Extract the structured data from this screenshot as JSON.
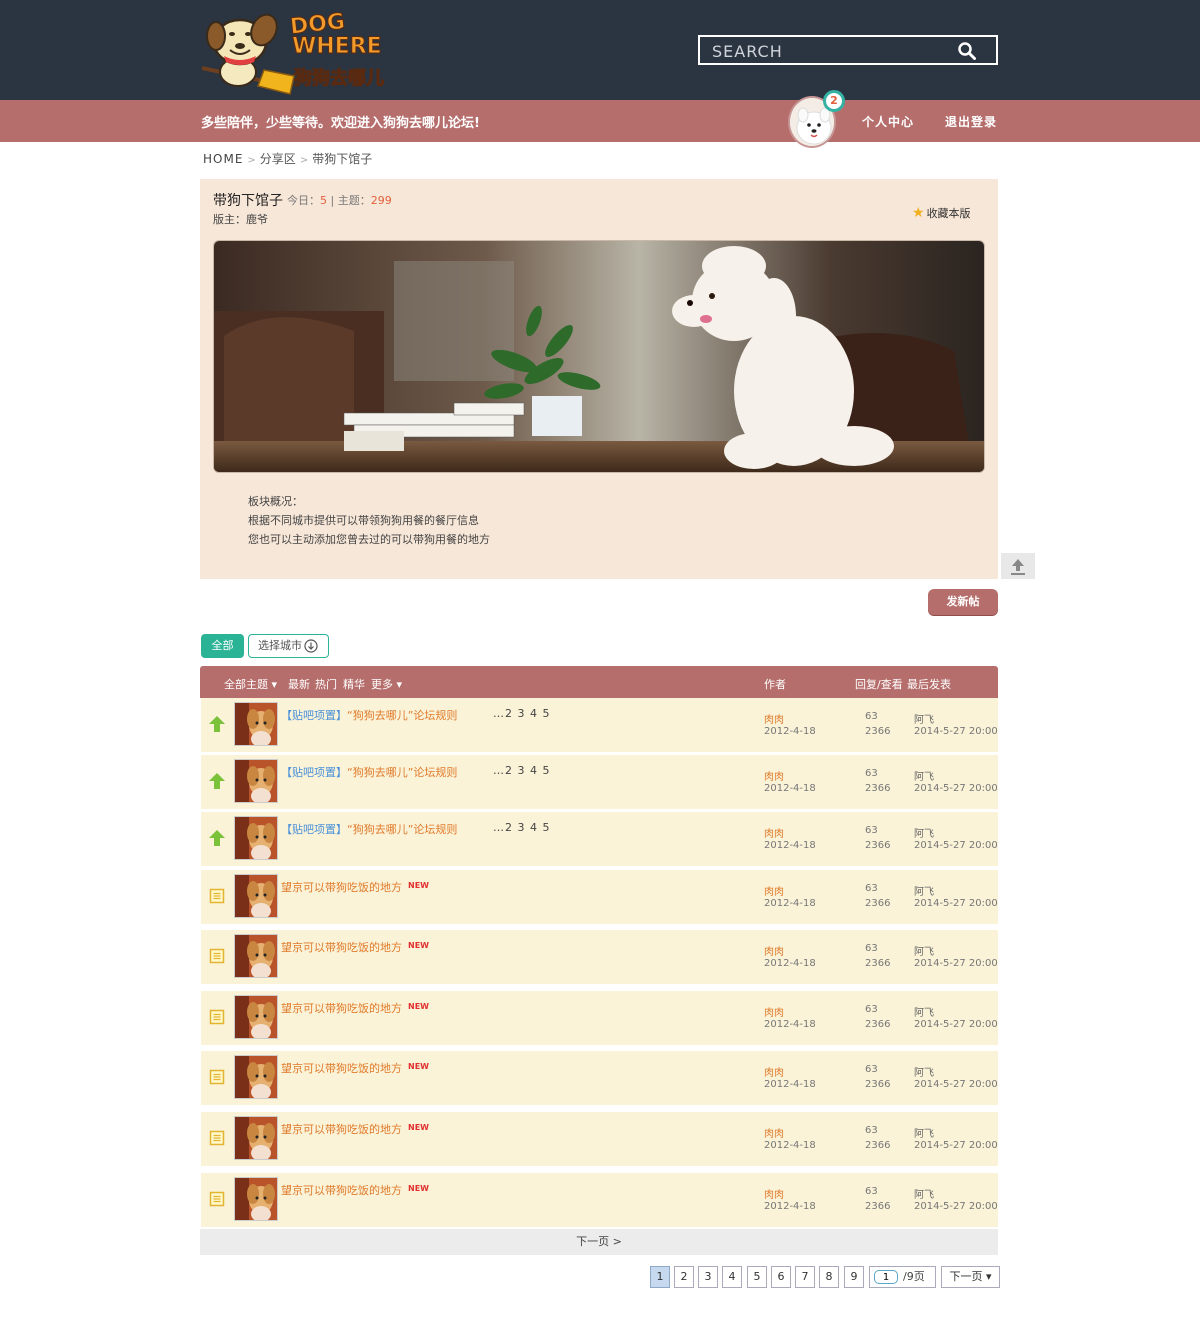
{
  "header": {
    "logo_text_line1": "DOG",
    "logo_text_line2": "WHERE",
    "logo_text_cn": "狗狗去哪儿",
    "search_placeholder": "SEARCH",
    "search_icon": "search-icon"
  },
  "subbar": {
    "slogan": "多些陪伴，少些等待。欢迎进入狗狗去哪儿论坛!",
    "notification_count": "2",
    "profile_link": "个人中心",
    "logout_link": "退出登录"
  },
  "breadcrumb": [
    "HOME",
    "分享区",
    "带狗下馆子"
  ],
  "board": {
    "title": "带狗下馆子",
    "today_label": "今日：",
    "today_value": "5",
    "divider": "|",
    "topics_label": "主题：",
    "topics_value": "299",
    "moderator": "版主：鹿爷",
    "favorite": "收藏本版",
    "desc_title": "板块概况：",
    "desc_line1": "根据不同城市提供可以带领狗狗用餐的餐厅信息",
    "desc_line2": "您也可以主动添加您曾去过的可以带狗用餐的地方"
  },
  "actions": {
    "new_post": "发新帖",
    "filter_all": "全部",
    "filter_city": "选择城市"
  },
  "table_header": {
    "all_topics": "全部主题",
    "latest": "最新",
    "hot": "热门",
    "featured": "精华",
    "more": "更多",
    "author": "作者",
    "reply_view": "回复/查看",
    "last_post": "最后发表"
  },
  "rows": [
    {
      "type": "pinned",
      "tag": "【贴吧项置】",
      "title": "“狗狗去哪儿”论坛规则",
      "pages": "…2 3 4 5",
      "author": "肉肉",
      "date": "2012-4-18",
      "replies": "63",
      "views": "2366",
      "last_user": "阿飞",
      "last_date": "2014-5-27 20:00"
    },
    {
      "type": "pinned",
      "tag": "【贴吧项置】",
      "title": "“狗狗去哪儿”论坛规则",
      "pages": "…2 3 4 5",
      "author": "肉肉",
      "date": "2012-4-18",
      "replies": "63",
      "views": "2366",
      "last_user": "阿飞",
      "last_date": "2014-5-27 20:00"
    },
    {
      "type": "pinned",
      "tag": "【贴吧项置】",
      "title": "“狗狗去哪儿”论坛规则",
      "pages": "…2 3 4 5",
      "author": "肉肉",
      "date": "2012-4-18",
      "replies": "63",
      "views": "2366",
      "last_user": "阿飞",
      "last_date": "2014-5-27 20:00"
    },
    {
      "type": "normal",
      "title": "望京可以带狗吃饭的地方",
      "badge": "NEW",
      "author": "肉肉",
      "date": "2012-4-18",
      "replies": "63",
      "views": "2366",
      "last_user": "阿飞",
      "last_date": "2014-5-27 20:00"
    },
    {
      "type": "normal",
      "title": "望京可以带狗吃饭的地方",
      "badge": "NEW",
      "author": "肉肉",
      "date": "2012-4-18",
      "replies": "63",
      "views": "2366",
      "last_user": "阿飞",
      "last_date": "2014-5-27 20:00"
    },
    {
      "type": "normal",
      "title": "望京可以带狗吃饭的地方",
      "badge": "NEW",
      "author": "肉肉",
      "date": "2012-4-18",
      "replies": "63",
      "views": "2366",
      "last_user": "阿飞",
      "last_date": "2014-5-27 20:00"
    },
    {
      "type": "normal",
      "title": "望京可以带狗吃饭的地方",
      "badge": "NEW",
      "author": "肉肉",
      "date": "2012-4-18",
      "replies": "63",
      "views": "2366",
      "last_user": "阿飞",
      "last_date": "2014-5-27 20:00"
    },
    {
      "type": "normal",
      "title": "望京可以带狗吃饭的地方",
      "badge": "NEW",
      "author": "肉肉",
      "date": "2012-4-18",
      "replies": "63",
      "views": "2366",
      "last_user": "阿飞",
      "last_date": "2014-5-27 20:00"
    },
    {
      "type": "normal",
      "title": "望京可以带狗吃饭的地方",
      "badge": "NEW",
      "author": "肉肉",
      "date": "2012-4-18",
      "replies": "63",
      "views": "2366",
      "last_user": "阿飞",
      "last_date": "2014-5-27 20:00"
    }
  ],
  "next_bar": "下一页 >",
  "pagination": {
    "pages": [
      "1",
      "2",
      "3",
      "4",
      "5",
      "6",
      "7",
      "8",
      "9"
    ],
    "current": "1",
    "jump_value": "1",
    "total": "/9页",
    "next": "下一页 ▾"
  },
  "colors": {
    "header_bg": "#2b3441",
    "subbar_bg": "#b56e6c",
    "board_bg": "#f7e7d8",
    "row_bg": "#faf3d8",
    "accent_green": "#2bb396",
    "title_orange": "#e07a2a"
  }
}
